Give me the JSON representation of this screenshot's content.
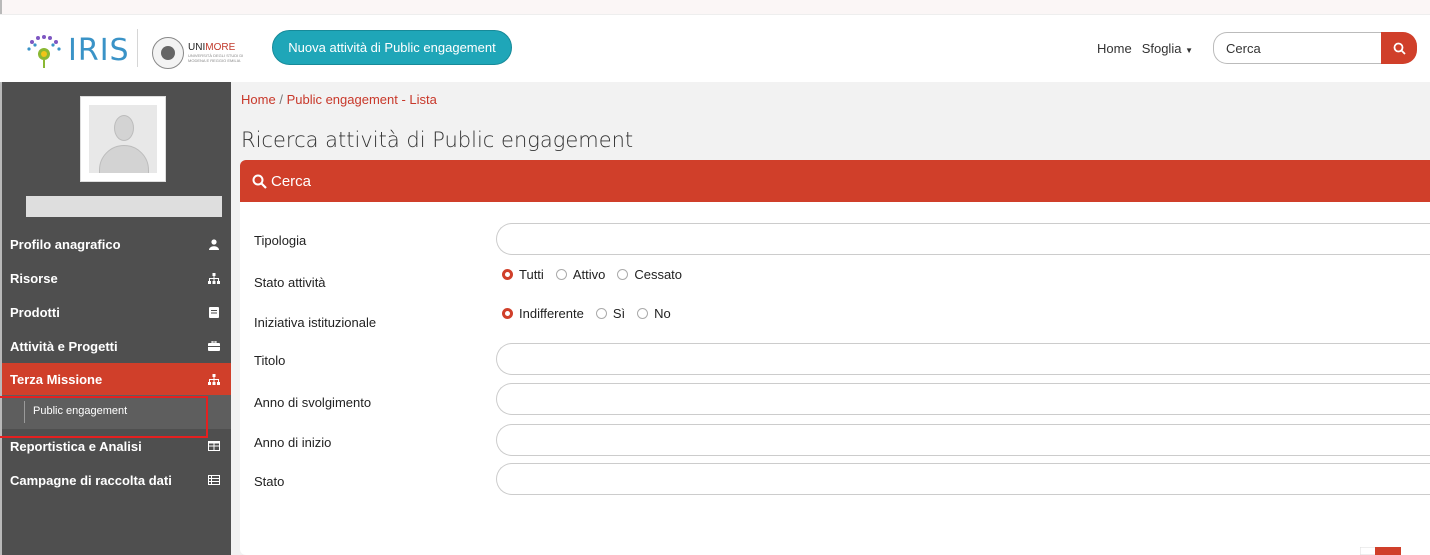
{
  "header": {
    "logo_text": "IRIS",
    "partner": {
      "name_a": "UNI",
      "name_b": "MORE",
      "sub": "UNIVERSITÀ DEGLI STUDI DI MODENA E REGGIO EMILIA"
    },
    "new_activity_label": "Nuova attività di Public engagement",
    "nav": {
      "home": "Home",
      "browse": "Sfoglia"
    },
    "search": {
      "placeholder": "Cerca"
    },
    "colors": {
      "accent": "#d03f2a",
      "teal": "#1fa6b8"
    }
  },
  "sidebar": {
    "items": [
      {
        "label": "Profilo anagrafico",
        "icon": "user-icon"
      },
      {
        "label": "Risorse",
        "icon": "sitemap-icon"
      },
      {
        "label": "Prodotti",
        "icon": "book-icon"
      },
      {
        "label": "Attività e Progetti",
        "icon": "briefcase-icon"
      },
      {
        "label": "Terza Missione",
        "icon": "sitemap-icon",
        "active": true
      },
      {
        "label": "Public engagement",
        "sub": true
      },
      {
        "label": "Reportistica e Analisi",
        "icon": "table-icon"
      },
      {
        "label": "Campagne di raccolta dati",
        "icon": "list-icon"
      }
    ]
  },
  "breadcrumb": {
    "home": "Home",
    "separator": "/",
    "current": "Public engagement - Lista"
  },
  "page_title": "Ricerca attività di Public engagement",
  "search_panel": {
    "title": "Cerca",
    "fields": {
      "tipologia": "Tipologia",
      "stato_attivita": "Stato attività",
      "iniziativa": "Iniziativa istituzionale",
      "titolo": "Titolo",
      "anno_svolgimento": "Anno di svolgimento",
      "anno_inizio": "Anno di inizio",
      "stato": "Stato"
    },
    "stato_attivita_options": [
      "Tutti",
      "Attivo",
      "Cessato"
    ],
    "stato_attivita_selected": "Tutti",
    "iniziativa_options": [
      "Indifferente",
      "Sì",
      "No"
    ],
    "iniziativa_selected": "Indifferente"
  }
}
